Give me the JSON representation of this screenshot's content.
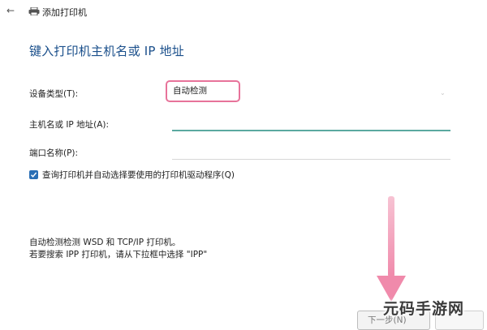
{
  "window": {
    "back_glyph": "←",
    "printer_icon": "printer-icon",
    "title": "添加打印机"
  },
  "heading": "键入打印机主机名或 IP 地址",
  "form": {
    "device_type": {
      "label": "设备类型(T):",
      "value": "自动检测"
    },
    "hostname": {
      "label": "主机名或 IP 地址(A):",
      "value": ""
    },
    "port_name": {
      "label": "端口名称(P):",
      "value": ""
    },
    "query_driver": {
      "label": "查询打印机并自动选择要使用的打印机驱动程序(Q)",
      "checked": true
    }
  },
  "info": {
    "line1": "自动检测检测 WSD 和 TCP/IP 打印机。",
    "line2": "若要搜索 IPP 打印机，请从下拉框中选择 \"IPP\""
  },
  "buttons": {
    "next_label": "下一步(N)"
  },
  "annotation": {
    "highlight_color": "#e7739a",
    "arrow_color": "#f29ab4"
  },
  "watermark": "元码手游网"
}
